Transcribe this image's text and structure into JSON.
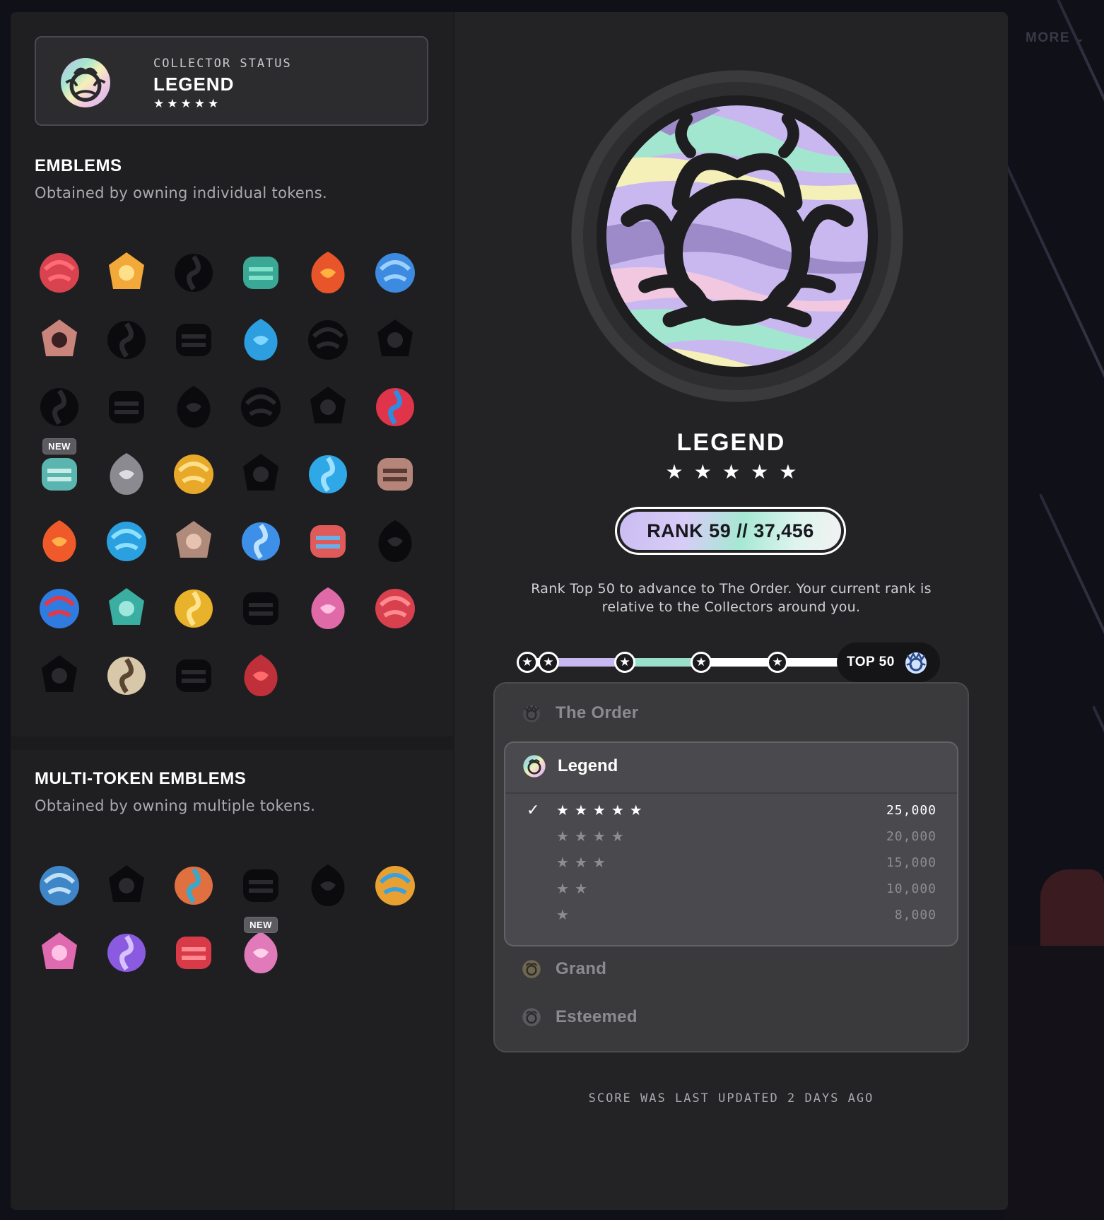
{
  "more_link": {
    "label": "MORE"
  },
  "status_card": {
    "label": "COLLECTOR STATUS",
    "title": "LEGEND",
    "stars": [
      "★",
      "★",
      "★",
      "★",
      "★"
    ]
  },
  "emblems": {
    "title": "EMBLEMS",
    "subtitle": "Obtained by owning individual tokens.",
    "items": [
      {
        "name": "torii",
        "color": "#d8434f",
        "accent": "#ff6a74"
      },
      {
        "name": "gold-helmet",
        "color": "#f2a93a",
        "accent": "#ffe08a"
      },
      {
        "name": "dark-shrine",
        "color": "#0b0b0d",
        "accent": "#2a2a2e"
      },
      {
        "name": "teal-frog",
        "color": "#3aa894",
        "accent": "#7fe3cc"
      },
      {
        "name": "fire-oni",
        "color": "#e8552a",
        "accent": "#ffb23f"
      },
      {
        "name": "blue-lotus",
        "color": "#3c8be0",
        "accent": "#9bd0ff"
      },
      {
        "name": "pink-mask",
        "color": "#c9857b",
        "accent": "#3a2020"
      },
      {
        "name": "dark-drake",
        "color": "#0b0b0d",
        "accent": "#2a2a2e"
      },
      {
        "name": "dark-butterfly",
        "color": "#0b0b0d",
        "accent": "#2a2a2e"
      },
      {
        "name": "blue-swirl",
        "color": "#2d9fe0",
        "accent": "#7fd6ff"
      },
      {
        "name": "dark-spiral",
        "color": "#0b0b0d",
        "accent": "#2a2a2e"
      },
      {
        "name": "dark-flower",
        "color": "#0b0b0d",
        "accent": "#2a2a2e"
      },
      {
        "name": "dark-bolt",
        "color": "#0b0b0d",
        "accent": "#2a2a2e"
      },
      {
        "name": "dark-peak",
        "color": "#0b0b0d",
        "accent": "#2a2a2e"
      },
      {
        "name": "dark-leaf",
        "color": "#0b0b0d",
        "accent": "#2a2a2e"
      },
      {
        "name": "dark-waves",
        "color": "#0b0b0d",
        "accent": "#2a2a2e"
      },
      {
        "name": "dark-clover",
        "color": "#0b0b0d",
        "accent": "#2a2a2e"
      },
      {
        "name": "red-blue-orb",
        "color": "#e0344a",
        "accent": "#2f8be0"
      },
      {
        "name": "teal-book",
        "color": "#5ab5b0",
        "accent": "#c7ece6",
        "new": true
      },
      {
        "name": "silver-star",
        "color": "#8a8a90",
        "accent": "#dcdce2"
      },
      {
        "name": "gold-star",
        "color": "#e8a92a",
        "accent": "#ffe08a"
      },
      {
        "name": "dark-vortex",
        "color": "#0b0b0d",
        "accent": "#2a2a2e"
      },
      {
        "name": "blue-power",
        "color": "#2fa8e8",
        "accent": "#9ee1ff"
      },
      {
        "name": "bronze-bear",
        "color": "#b5857a",
        "accent": "#5a3a34"
      },
      {
        "name": "flame",
        "color": "#f05a2a",
        "accent": "#ffb24a"
      },
      {
        "name": "blue-wave",
        "color": "#2aa0e0",
        "accent": "#8ee0ff"
      },
      {
        "name": "bronze-tree",
        "color": "#b08a7a",
        "accent": "#e6c2b0"
      },
      {
        "name": "blue-lightning",
        "color": "#3d8fe8",
        "accent": "#bfe3ff"
      },
      {
        "name": "prism-star",
        "color": "#e05a5a",
        "accent": "#6ab0e8"
      },
      {
        "name": "dark-pinwheel",
        "color": "#0b0b0d",
        "accent": "#2a2a2e"
      },
      {
        "name": "rgb-knot",
        "color": "#2f7be0",
        "accent": "#e03a4a"
      },
      {
        "name": "teal-question",
        "color": "#3aaea0",
        "accent": "#9fe6dc"
      },
      {
        "name": "gold-question",
        "color": "#e8b22a",
        "accent": "#ffe490"
      },
      {
        "name": "dark-question",
        "color": "#0b0b0d",
        "accent": "#2a2a2e"
      },
      {
        "name": "pink-swirl",
        "color": "#e06aa8",
        "accent": "#ffc2e2"
      },
      {
        "name": "red-crown",
        "color": "#d8404e",
        "accent": "#ff8a90"
      },
      {
        "name": "dark-face",
        "color": "#0b0b0d",
        "accent": "#2a2a2e"
      },
      {
        "name": "ivory-sheaf",
        "color": "#d8c7a8",
        "accent": "#5a4630"
      },
      {
        "name": "dark-dragon",
        "color": "#0b0b0d",
        "accent": "#2a2a2e"
      },
      {
        "name": "red-kanji",
        "color": "#c0303a",
        "accent": "#ff6a6a"
      }
    ]
  },
  "multi_emblems": {
    "title": "MULTI-TOKEN EMBLEMS",
    "subtitle": "Obtained by owning multiple tokens.",
    "items": [
      {
        "name": "blue-glyph",
        "color": "#3f86c8",
        "accent": "#bfe0f5"
      },
      {
        "name": "dark-flower-multi",
        "color": "#0b0b0d",
        "accent": "#2a2a2e"
      },
      {
        "name": "tri-color-mask",
        "color": "#e07040",
        "accent": "#3aa8c8"
      },
      {
        "name": "dark-spiral-multi",
        "color": "#0b0b0d",
        "accent": "#2a2a2e"
      },
      {
        "name": "dark-rings",
        "color": "#0b0b0d",
        "accent": "#2a2a2e"
      },
      {
        "name": "prism-compass",
        "color": "#e8a030",
        "accent": "#3aa0e0"
      },
      {
        "name": "pink-knot",
        "color": "#e06ab0",
        "accent": "#ffc2e6"
      },
      {
        "name": "violet-waves",
        "color": "#8a5ae0",
        "accent": "#d7c2ff"
      },
      {
        "name": "red-loop",
        "color": "#d83a48",
        "accent": "#ff8a92"
      },
      {
        "name": "pink-bubbles",
        "color": "#e07ab8",
        "accent": "#ffd0ea",
        "new": true
      }
    ]
  },
  "new_badge": "NEW",
  "rank": {
    "name": "LEGEND",
    "stars": [
      "★",
      "★",
      "★",
      "★",
      "★"
    ],
    "pill": "RANK 59 // 37,456",
    "description": "Rank Top 50 to advance to The Order. Your current rank is relative to the Collectors around you.",
    "node_icon": "★",
    "goal_label": "TOP 50",
    "progress_nodes": 5
  },
  "tiers": {
    "order": {
      "name": "The Order"
    },
    "legend": {
      "name": "Legend",
      "levels": [
        {
          "check": "✓",
          "stars": [
            "★",
            "★",
            "★",
            "★",
            "★"
          ],
          "points": "25,000",
          "active": true
        },
        {
          "check": "",
          "stars": [
            "★",
            "★",
            "★",
            "★"
          ],
          "points": "20,000",
          "active": false
        },
        {
          "check": "",
          "stars": [
            "★",
            "★",
            "★"
          ],
          "points": "15,000",
          "active": false
        },
        {
          "check": "",
          "stars": [
            "★",
            "★"
          ],
          "points": "10,000",
          "active": false
        },
        {
          "check": "",
          "stars": [
            "★"
          ],
          "points": "8,000",
          "active": false
        }
      ]
    },
    "grand": {
      "name": "Grand"
    },
    "esteemed": {
      "name": "Esteemed"
    }
  },
  "footnote": "SCORE WAS LAST UPDATED 2 DAYS AGO",
  "colors": {
    "holo_lilac": "#c9b8f0",
    "holo_mint": "#a3e6d0",
    "holo_cream": "#f5f0b8",
    "holo_pink": "#f2c8e0",
    "panel_bg": "#232325"
  }
}
